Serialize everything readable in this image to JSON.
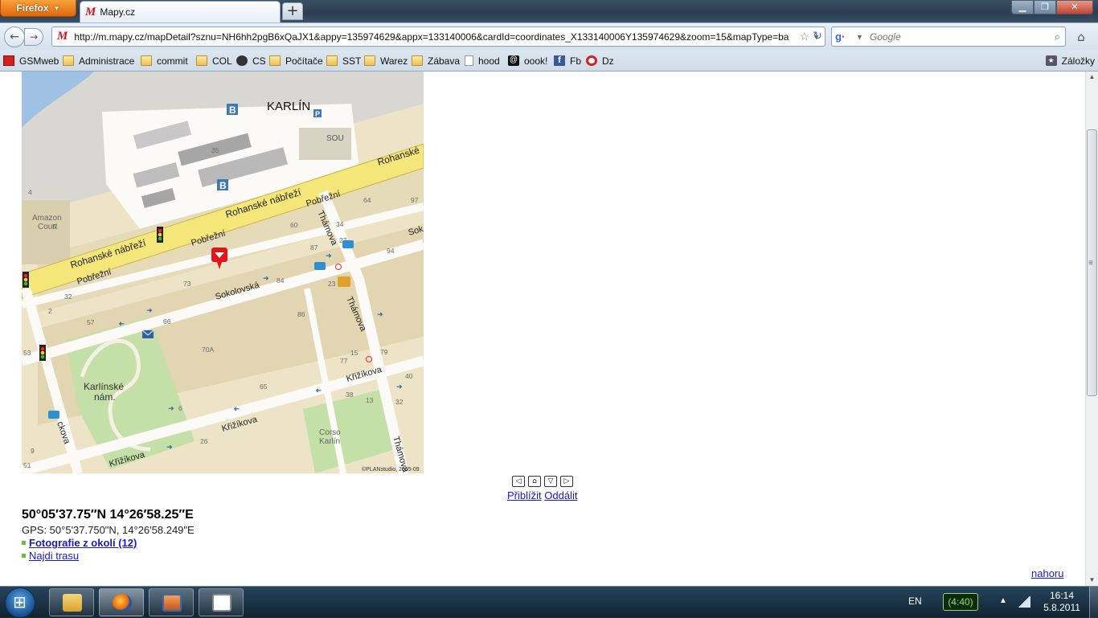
{
  "browser": {
    "app_button": "Firefox",
    "tab_title": "Mapy.cz",
    "url": "http://m.mapy.cz/mapDetail?sznu=NH6hh2pgB6xQaJX1&appy=135974629&appx=133140006&cardId=coordinates_X133140006Y135974629&zoom=15&mapType=ba",
    "search_placeholder": "Google"
  },
  "bookmarks": [
    {
      "label": "GSMweb",
      "icon": "gsmweb-icon"
    },
    {
      "label": "Administrace",
      "icon": "folder-icon"
    },
    {
      "label": "commit",
      "icon": "folder-icon"
    },
    {
      "label": "COL",
      "icon": "folder-icon"
    },
    {
      "label": "CS",
      "icon": "cs-icon"
    },
    {
      "label": "Počítače",
      "icon": "folder-icon"
    },
    {
      "label": "SST",
      "icon": "folder-icon"
    },
    {
      "label": "Warez",
      "icon": "folder-icon"
    },
    {
      "label": "Zábava",
      "icon": "folder-icon"
    },
    {
      "label": "hood",
      "icon": "page-icon"
    },
    {
      "label": "oook!",
      "icon": "at-icon"
    },
    {
      "label": "Fb",
      "icon": "facebook-icon"
    },
    {
      "label": "Dz",
      "icon": "target-icon"
    }
  ],
  "bookmarks_menu": "Záložky",
  "map": {
    "labels": {
      "district": "KARLÍN",
      "amazon": "Amazon",
      "court": "Court",
      "sou": "SOU",
      "square_1": "Karlínské",
      "square_2": "nám.",
      "corso_1": "Corso",
      "corso_2": "Karlín",
      "copyright": "©PLANstudio, 2005-09"
    },
    "streets": {
      "rohanske_1": "Rohanské nábřeží",
      "rohanske_2": "Rohanské nábřeží",
      "rohanske_3": "Rohanské",
      "pobrezni_1": "Pobřežní",
      "pobrezni_2": "Pobřežní",
      "pobrezni_3": "Pobřežní",
      "thamova_1": "Thámova",
      "thamova_2": "Thámova",
      "thamova_3": "Thámova",
      "sokolovska_1": "Sokolovská",
      "sokolovska_2": "Sok",
      "krizikova_1": "Křižíkova",
      "krizikova_2": "Křižíkova",
      "krizikova_3": "Křižíkova",
      "ckova": "ckova"
    },
    "house_numbers": {
      "n35": "35",
      "n4": "4",
      "n5": "5",
      "n64": "64",
      "n97": "97",
      "n60": "60",
      "n34": "34",
      "n27": "27",
      "n87": "87",
      "n94": "94",
      "n73": "73",
      "n84": "84",
      "n23": "23",
      "n32": "32",
      "n2": "2",
      "n57": "57",
      "n66": "66",
      "n86": "86",
      "n70a": "70A",
      "n77": "77",
      "n15": "15",
      "n79": "79",
      "n40": "40",
      "n32b": "32",
      "n65": "65",
      "n38": "38",
      "n13": "13",
      "n6": "6",
      "n26": "26",
      "n9": "9",
      "n51": "51",
      "n53": "53"
    },
    "parking_letter": "P",
    "bus_letter": "B"
  },
  "map_controls": {
    "left": "◁",
    "up": "⌂",
    "down": "▽",
    "right": "▷",
    "zoom_in": "Přiblížit",
    "zoom_out": "Oddálit"
  },
  "location": {
    "coords": "50°05′37.75″N 14°26′58.25″E",
    "gps": "GPS: 50°5'37.750\"N, 14°26'58.249\"E",
    "photos_link": "Fotografie z okolí (12)",
    "route_link": "Najdi trasu",
    "top_link": "nahoru"
  },
  "taskbar": {
    "language": "EN",
    "battery": "(4:40)",
    "time": "16:14",
    "date": "5.8.2011"
  }
}
